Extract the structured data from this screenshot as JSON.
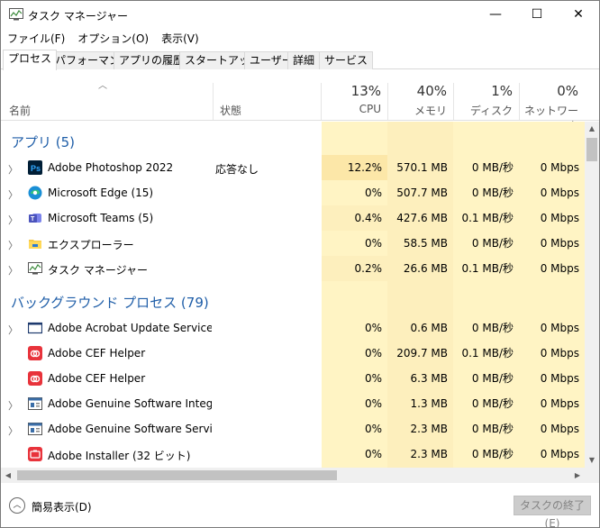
{
  "window": {
    "title": "タスク マネージャー",
    "controls": {
      "minimize": "—",
      "maximize": "☐",
      "close": "✕"
    }
  },
  "menu": [
    "ファイル(F)",
    "オプション(O)",
    "表示(V)"
  ],
  "tabs": [
    {
      "label": "プロセス",
      "active": true
    },
    {
      "label": "パフォーマンス",
      "active": false
    },
    {
      "label": "アプリの履歴",
      "active": false
    },
    {
      "label": "スタートアップ",
      "active": false
    },
    {
      "label": "ユーザー",
      "active": false
    },
    {
      "label": "詳細",
      "active": false
    },
    {
      "label": "サービス",
      "active": false
    }
  ],
  "columns": {
    "name": "名前",
    "status": "状態",
    "cpu": {
      "pct": "13%",
      "label": "CPU"
    },
    "memory": {
      "pct": "40%",
      "label": "メモリ"
    },
    "disk": {
      "pct": "1%",
      "label": "ディスク"
    },
    "network": {
      "pct": "0%",
      "label": "ネットワーク"
    }
  },
  "groups": [
    {
      "title": "アプリ (5)",
      "rows": [
        {
          "name": "Adobe Photoshop 2022",
          "status": "応答なし",
          "cpu": "12.2%",
          "memory": "570.1 MB",
          "disk": "0 MB/秒",
          "network": "0 Mbps",
          "icon": "photoshop-icon",
          "expandable": true,
          "cpu_heat": "#fce7a8"
        },
        {
          "name": "Microsoft Edge (15)",
          "status": "",
          "cpu": "0%",
          "memory": "507.7 MB",
          "disk": "0 MB/秒",
          "network": "0 Mbps",
          "icon": "edge-icon",
          "expandable": true,
          "cpu_heat": "#fff4c4"
        },
        {
          "name": "Microsoft Teams (5)",
          "status": "",
          "cpu": "0.4%",
          "memory": "427.6 MB",
          "disk": "0.1 MB/秒",
          "network": "0 Mbps",
          "icon": "teams-icon",
          "expandable": true,
          "cpu_heat": "#fdefbd"
        },
        {
          "name": "エクスプローラー",
          "status": "",
          "cpu": "0%",
          "memory": "58.5 MB",
          "disk": "0 MB/秒",
          "network": "0 Mbps",
          "icon": "explorer-icon",
          "expandable": true,
          "cpu_heat": "#fff4c4"
        },
        {
          "name": "タスク マネージャー",
          "status": "",
          "cpu": "0.2%",
          "memory": "26.6 MB",
          "disk": "0.1 MB/秒",
          "network": "0 Mbps",
          "icon": "task-manager-icon",
          "expandable": true,
          "cpu_heat": "#fdefbd"
        }
      ]
    },
    {
      "title": "バックグラウンド プロセス (79)",
      "rows": [
        {
          "name": "Adobe Acrobat Update Service (...",
          "status": "",
          "cpu": "0%",
          "memory": "0.6 MB",
          "disk": "0 MB/秒",
          "network": "0 Mbps",
          "icon": "window-icon",
          "expandable": true,
          "cpu_heat": "#fff4c4"
        },
        {
          "name": "Adobe CEF Helper",
          "status": "",
          "cpu": "0%",
          "memory": "209.7 MB",
          "disk": "0.1 MB/秒",
          "network": "0 Mbps",
          "icon": "creative-cloud-icon",
          "expandable": false,
          "cpu_heat": "#fff4c4"
        },
        {
          "name": "Adobe CEF Helper",
          "status": "",
          "cpu": "0%",
          "memory": "6.3 MB",
          "disk": "0 MB/秒",
          "network": "0 Mbps",
          "icon": "creative-cloud-icon",
          "expandable": false,
          "cpu_heat": "#fff4c4"
        },
        {
          "name": "Adobe Genuine Software Integri...",
          "status": "",
          "cpu": "0%",
          "memory": "1.3 MB",
          "disk": "0 MB/秒",
          "network": "0 Mbps",
          "icon": "service-icon",
          "expandable": true,
          "cpu_heat": "#fff4c4"
        },
        {
          "name": "Adobe Genuine Software Servic...",
          "status": "",
          "cpu": "0%",
          "memory": "2.3 MB",
          "disk": "0 MB/秒",
          "network": "0 Mbps",
          "icon": "service-icon",
          "expandable": true,
          "cpu_heat": "#fff4c4"
        },
        {
          "name": "Adobe Installer (32 ビット)",
          "status": "",
          "cpu": "0%",
          "memory": "2.3 MB",
          "disk": "0 MB/秒",
          "network": "0 Mbps",
          "icon": "adobe-installer-icon",
          "expandable": false,
          "cpu_heat": "#fff4c4"
        }
      ]
    }
  ],
  "footer": {
    "fewer_details": "簡易表示(D)",
    "end_task": "タスクの終了(E)"
  },
  "colors": {
    "group_title": "#1f5ea8",
    "heat_light": "#fff4c4",
    "heat_medium": "#fdefbd",
    "heat_high": "#fce7a8",
    "memory_heat": "#fdefbd"
  }
}
